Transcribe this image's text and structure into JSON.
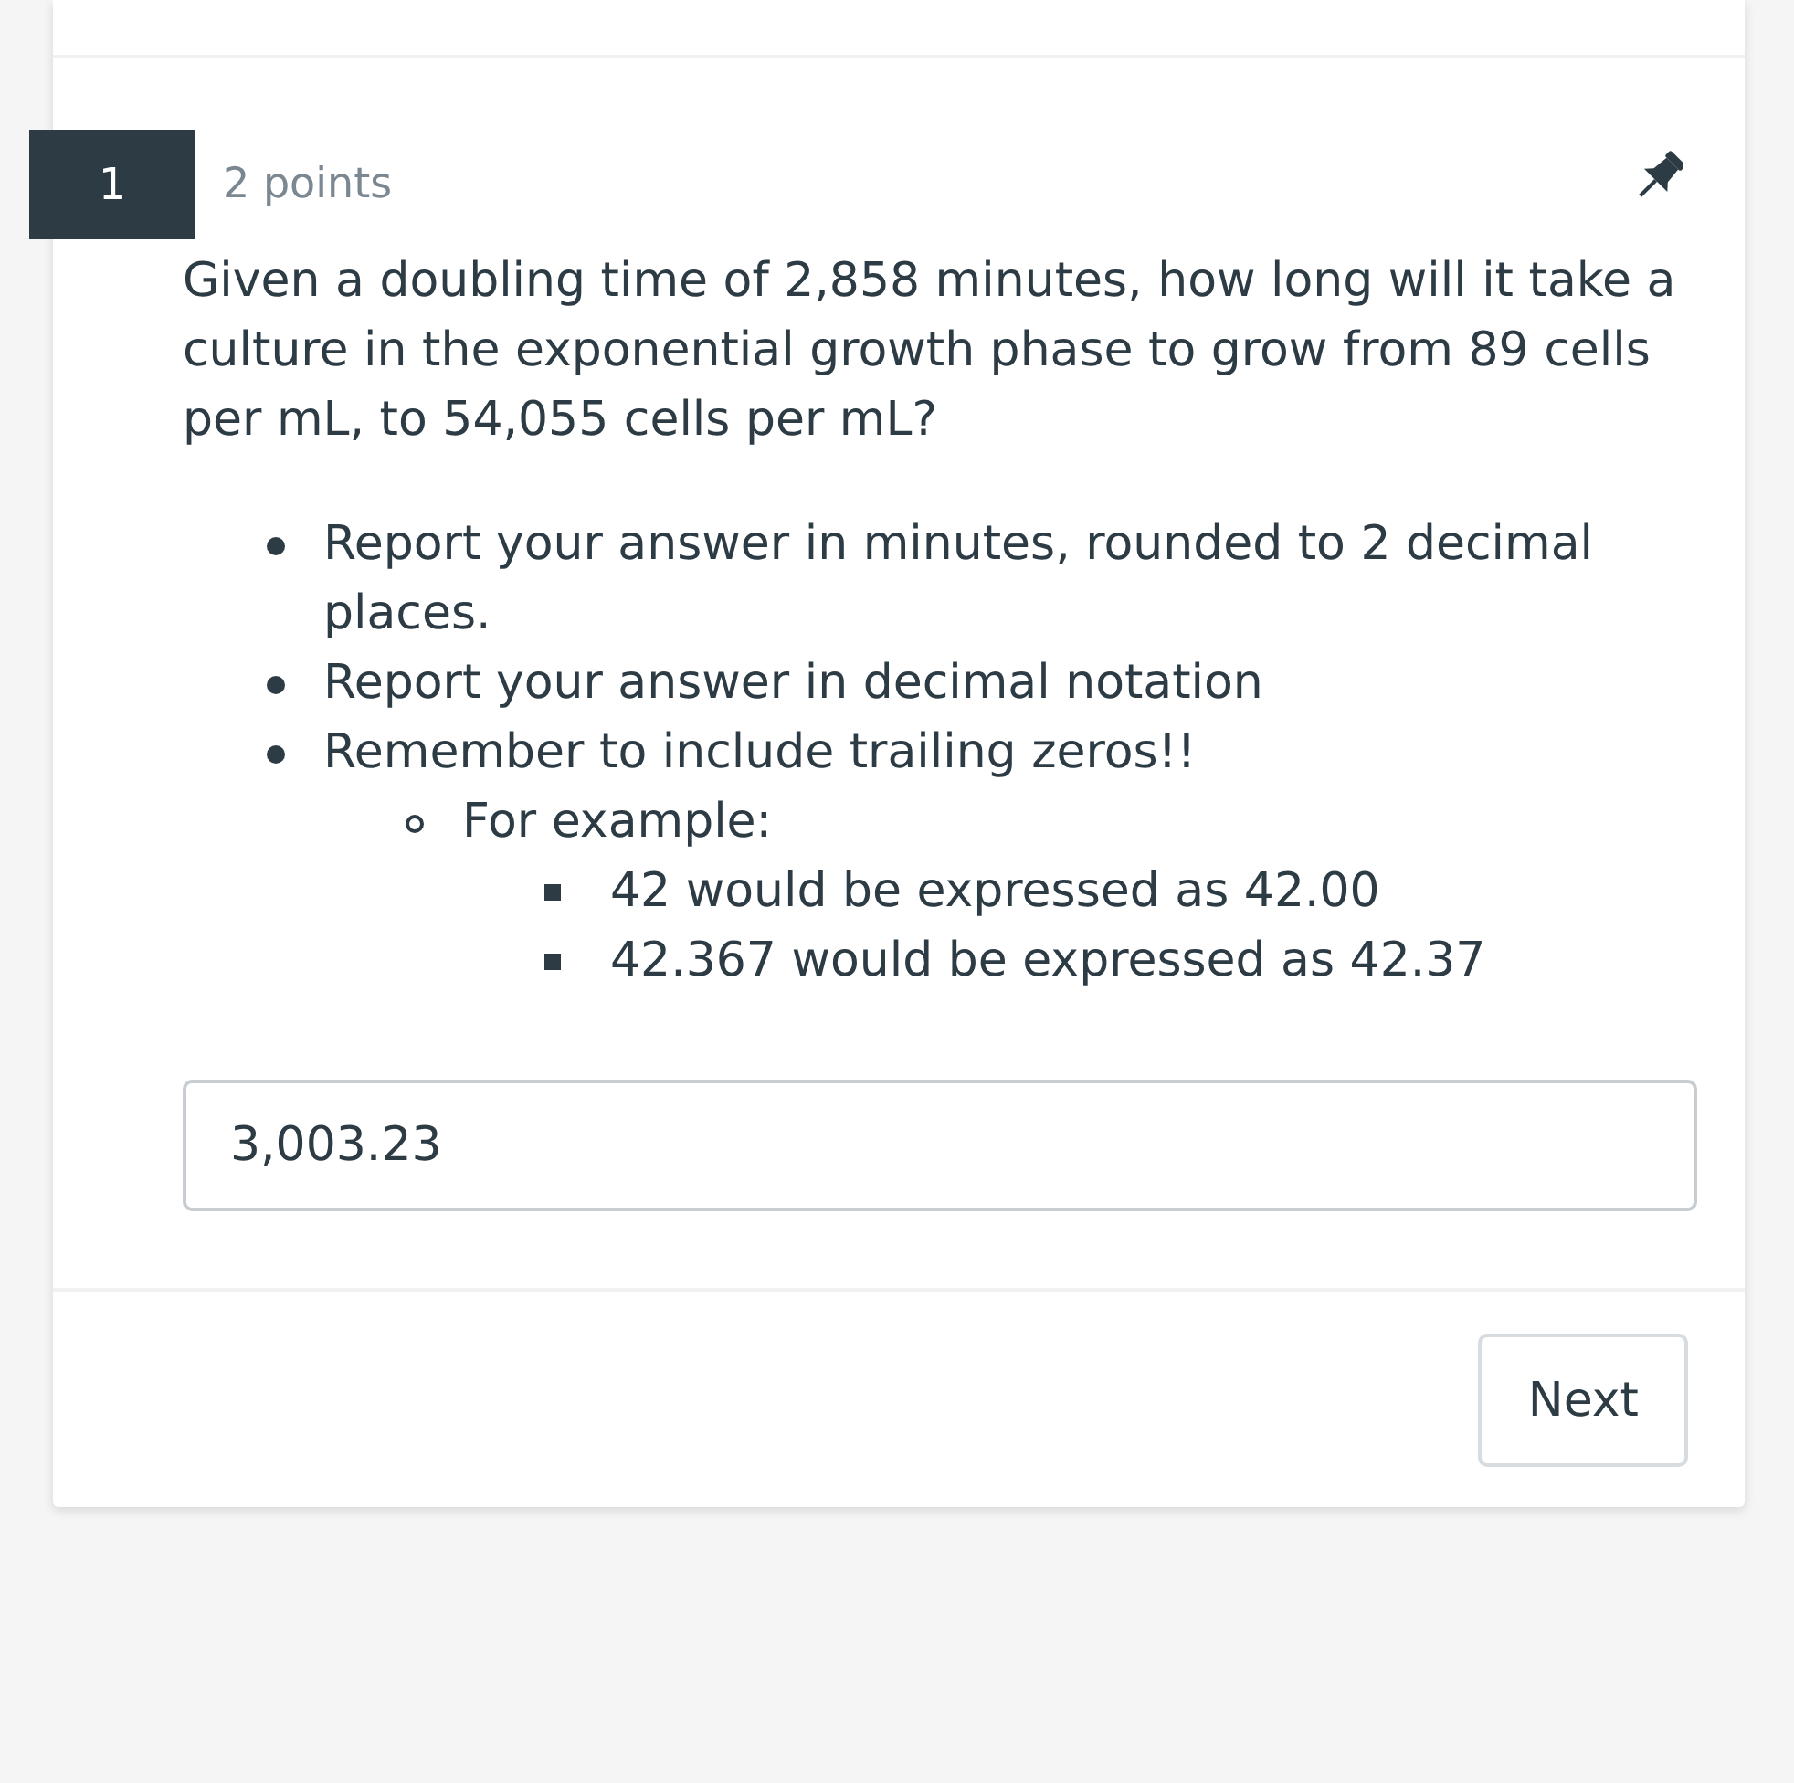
{
  "question": {
    "number": "1",
    "points": "2 points",
    "text": "Given a doubling time of 2,858 minutes, how long will it take a culture in the exponential growth phase to grow from 89 cells per mL, to 54,055 cells per mL?",
    "instructions": [
      {
        "text": "Report your answer in minutes, rounded to 2 decimal places."
      },
      {
        "text": "Report your answer in decimal notation"
      },
      {
        "text": "Remember to include trailing zeros!!",
        "children": [
          {
            "text": "For example:",
            "children": [
              {
                "text": "42 would be expressed as 42.00"
              },
              {
                "text": "42.367 would be expressed as 42.37"
              }
            ]
          }
        ]
      }
    ],
    "answer": {
      "value": "3,003.23"
    }
  },
  "buttons": [
    {
      "label": "Next"
    }
  ]
}
